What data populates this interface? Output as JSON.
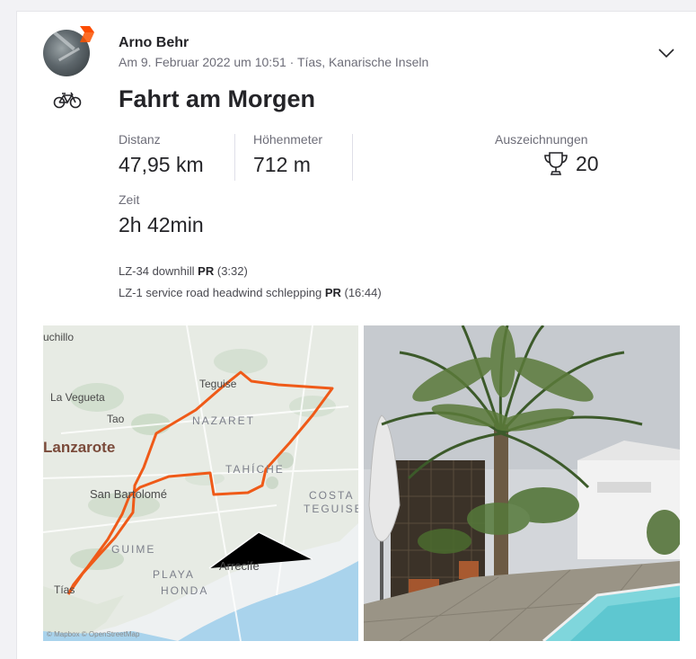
{
  "activity": {
    "athlete_name": "Arno Behr",
    "meta": "Am 9. Februar 2022 um 10:51 · Tías, Kanarische Inseln",
    "title": "Fahrt am Morgen",
    "sport_icon": "bike-icon"
  },
  "stats": {
    "distance": {
      "label": "Distanz",
      "value": "47,95 km"
    },
    "elevation": {
      "label": "Höhenmeter",
      "value": "712 m"
    },
    "time": {
      "label": "Zeit",
      "value": "2h 42min"
    },
    "awards": {
      "label": "Auszeichnungen",
      "value": "20",
      "icon": "trophy-icon"
    }
  },
  "segments": [
    {
      "name": "LZ-34 downhill",
      "badge": "PR",
      "time": "(3:32)"
    },
    {
      "name": "LZ-1 service road headwind schlepping",
      "badge": "PR",
      "time": "(16:44)"
    }
  ],
  "map": {
    "labels": {
      "puchillo": "uchillo",
      "vegueta": "La Vegueta",
      "tao": "Tao",
      "lanzarote": "Lanzarote",
      "teguise": "Teguise",
      "nazaret": "NAZARET",
      "tahiche": "TAHÍCHE",
      "costa": "COSTA",
      "teguise2": "TEGUISE",
      "sanbartolome": "San Bartolomé",
      "guime": "GUIME",
      "playa": "PLAYA",
      "honda": "HONDA",
      "arrecife": "Arrecife",
      "tias": "Tías"
    },
    "attribution": "© Mapbox © OpenStreetMap",
    "route_color": "#ef5a18"
  },
  "colors": {
    "brand": "#fc4c02",
    "text": "#242428",
    "muted": "#6d6d78"
  }
}
